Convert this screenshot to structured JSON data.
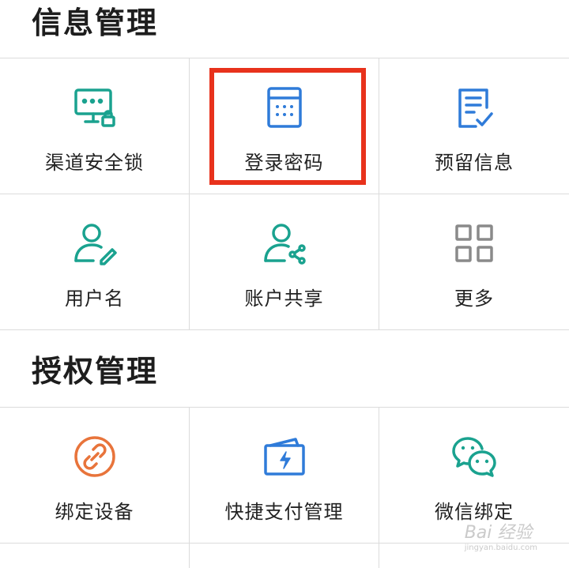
{
  "sections": [
    {
      "title": "信息管理",
      "items": [
        {
          "label": "渠道安全锁",
          "icon": "monitor-lock-icon"
        },
        {
          "label": "登录密码",
          "icon": "keypad-icon"
        },
        {
          "label": "预留信息",
          "icon": "document-check-icon"
        },
        {
          "label": "用户名",
          "icon": "user-edit-icon"
        },
        {
          "label": "账户共享",
          "icon": "user-share-icon"
        },
        {
          "label": "更多",
          "icon": "grid-icon"
        }
      ]
    },
    {
      "title": "授权管理",
      "items": [
        {
          "label": "绑定设备",
          "icon": "link-icon"
        },
        {
          "label": "快捷支付管理",
          "icon": "card-flash-icon"
        },
        {
          "label": "微信绑定",
          "icon": "wechat-icon"
        }
      ]
    }
  ],
  "watermark": {
    "brand": "Bai 经验",
    "url": "jingyan.baidu.com"
  },
  "colors": {
    "green": "#1aa28f",
    "blue": "#2f7bd9",
    "orange": "#e8743b",
    "gray": "#8a8a8a",
    "highlight": "#e8321c"
  }
}
